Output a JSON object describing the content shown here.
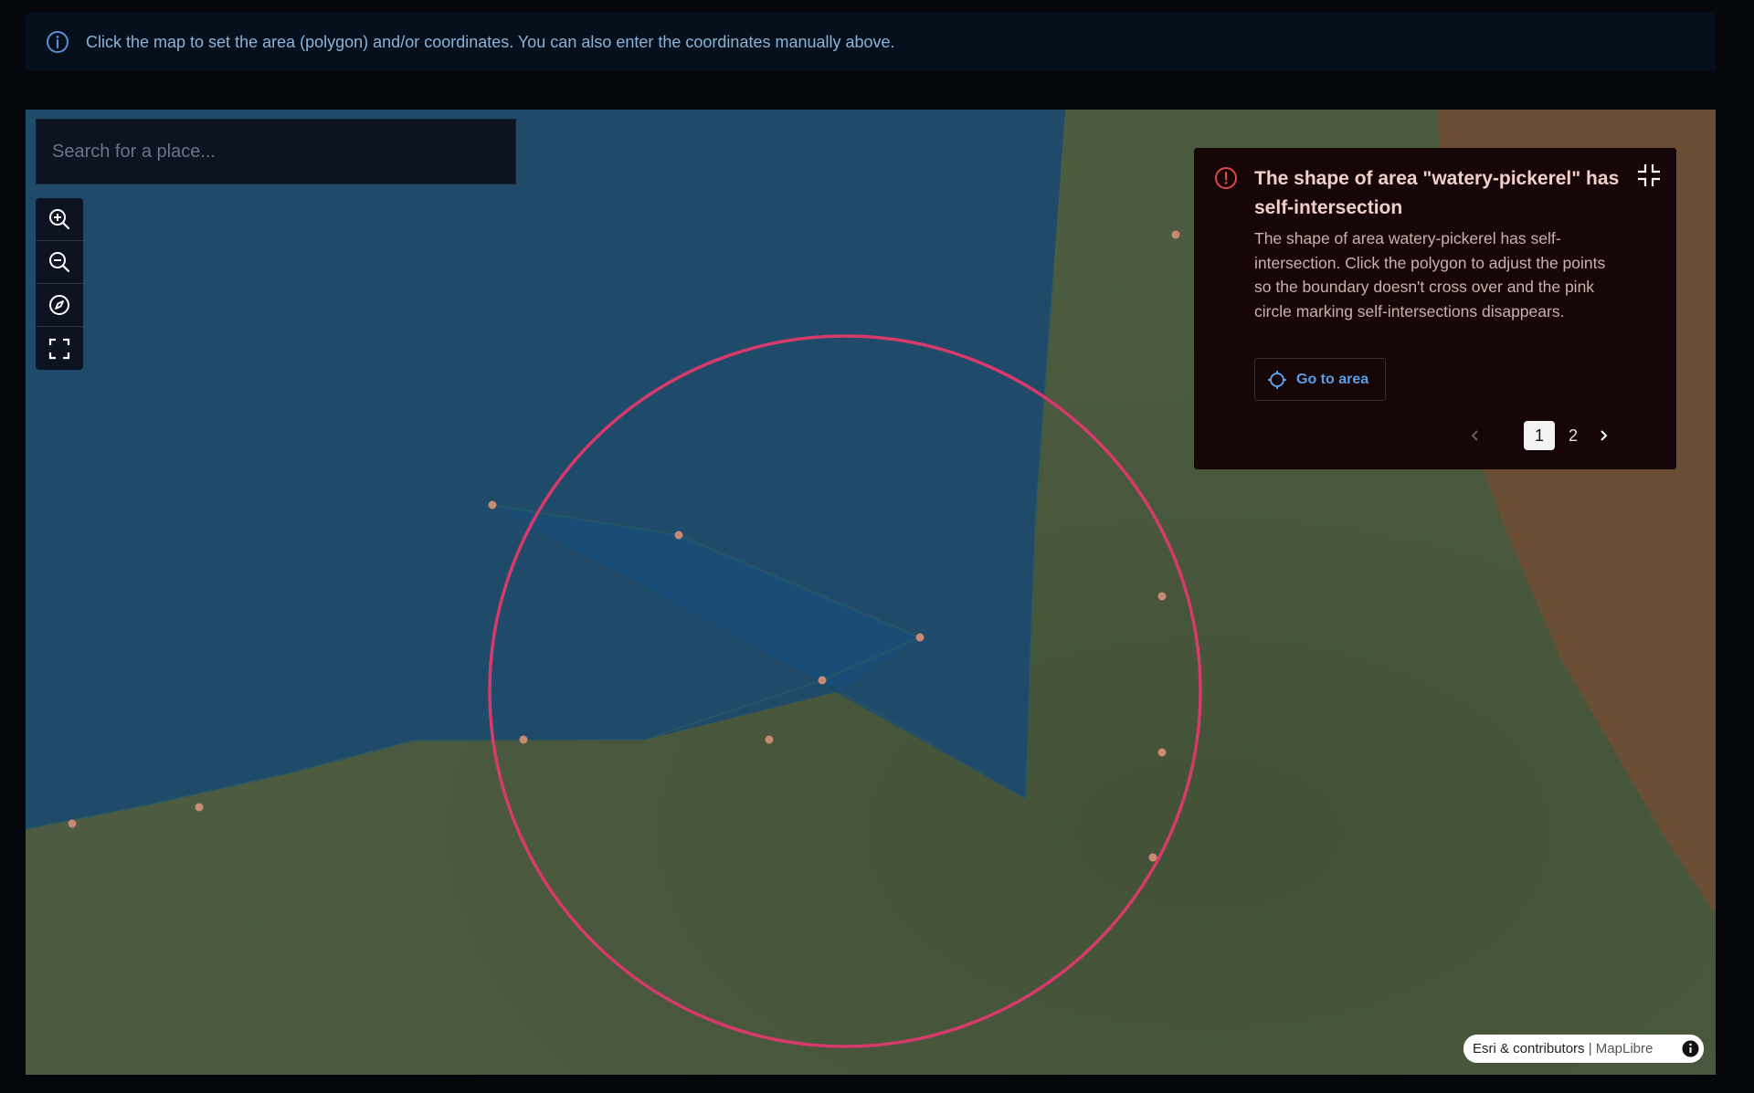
{
  "info_bar": {
    "icon": "info-circle-icon",
    "text": "Click the map to set the area (polygon) and/or coordinates. You can also enter the coordinates manually above."
  },
  "map": {
    "search": {
      "placeholder": "Search for a place..."
    },
    "controls": [
      {
        "name": "zoom-in",
        "icon": "zoom-in-icon"
      },
      {
        "name": "zoom-out",
        "icon": "zoom-out-icon"
      },
      {
        "name": "compass",
        "icon": "compass-icon"
      },
      {
        "name": "fullscreen",
        "icon": "fullscreen-icon"
      }
    ],
    "attribution": {
      "source": "Esri & contributors",
      "separator": "|",
      "library": "MapLibre"
    },
    "colors": {
      "water": "#1f4a6a",
      "land": "#4b5a3e",
      "desert": "#6b4e36",
      "selection": "#1a4d78",
      "vertex": "#c98a73",
      "intersection_ring": "#d63a6a"
    }
  },
  "error_popup": {
    "icon": "alert-circle-icon",
    "title": "The shape of area \"watery-pickerel\" has self-intersection",
    "body": "The shape of area watery-pickerel has self-intersection. Click the polygon to adjust the points so the boundary doesn't cross over and the pink circle marking self-intersections disappears.",
    "go_to_area_label": "Go to area",
    "pagination": {
      "current": "1",
      "other": "2"
    },
    "colors": {
      "title": "#f2cfca",
      "link": "#5a9ee8",
      "warn": "#e04848"
    }
  }
}
